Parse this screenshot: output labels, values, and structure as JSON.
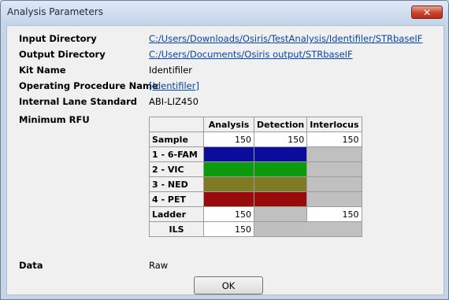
{
  "window": {
    "title": "Analysis Parameters",
    "close_glyph": "✕"
  },
  "fields": [
    {
      "label": "Input Directory",
      "value": "C:/Users/Downloads/Osiris/TestAnalysis/Identifiler/STRbaseIF",
      "link": true
    },
    {
      "label": "Output Directory",
      "value": "C:/Users/Documents/Osiris output/STRbaseIF",
      "link": true
    },
    {
      "label": "Kit Name",
      "value": "Identifiler",
      "link": false
    },
    {
      "label": "Operating Procedure Name",
      "value": "[Identifiler]",
      "link": true
    },
    {
      "label": "Internal Lane Standard",
      "value": "ABI-LIZ450",
      "link": false
    }
  ],
  "min_rfu": {
    "label": "Minimum RFU",
    "columns": [
      "Analysis",
      "Detection",
      "Interlocus"
    ],
    "rows": {
      "sample": {
        "label": "Sample",
        "values": [
          "150",
          "150",
          "150"
        ]
      },
      "fam": {
        "label": "1 - 6-FAM",
        "color": "#0b0b9c"
      },
      "vic": {
        "label": "2 - VIC",
        "color": "#0d9a0d"
      },
      "ned": {
        "label": "3 - NED",
        "color": "#7f7a24"
      },
      "pet": {
        "label": "4 - PET",
        "color": "#990b0b"
      },
      "ladder": {
        "label": "Ladder",
        "analysis": "150",
        "interlocus": "150"
      },
      "ils": {
        "label": "ILS",
        "analysis": "150"
      }
    }
  },
  "data_field": {
    "label": "Data",
    "value": "Raw"
  },
  "ok_label": "OK"
}
